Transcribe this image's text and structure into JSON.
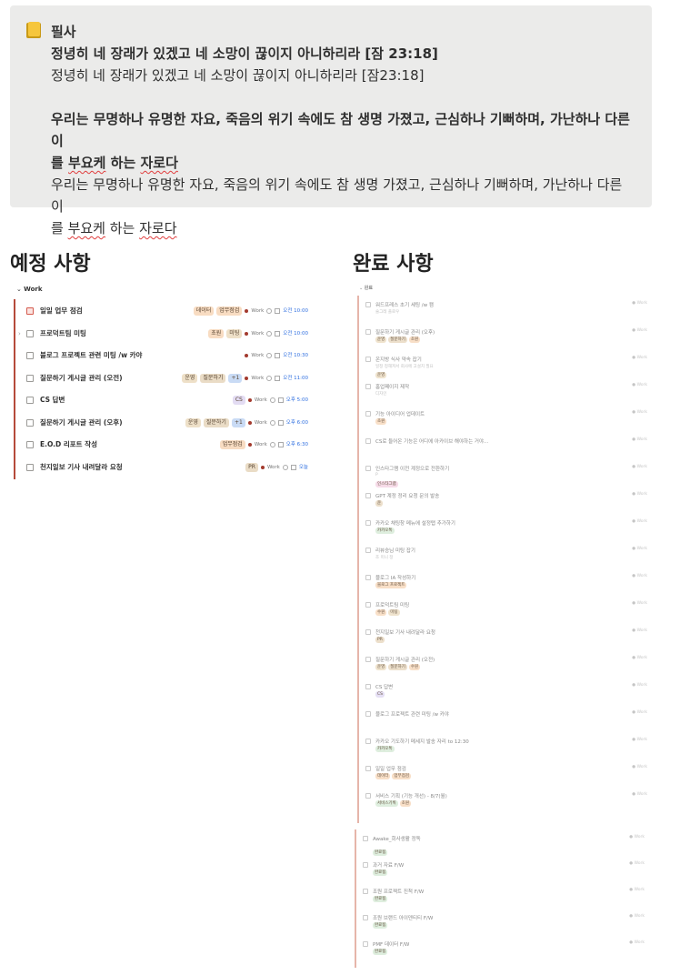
{
  "callout": {
    "icon": "notebook-icon",
    "title": "필사",
    "verse1_bold": "정녕히 네 장래가 있겠고 네 소망이 끊이지 아니하리라 [잠 23:18]",
    "verse1": "정녕히 네 장래가 있겠고 네 소망이 끊이지 아니하리라 [잠23:18]",
    "verse2_bold_a": "우리는 무명하나 유명한 자요, 죽음의 위기 속에도 참 생명 가졌고, 근심하나 기뻐하며, 가난하나 다른 이",
    "verse2_bold_b1": "를 ",
    "verse2_bold_b2": "부요케",
    "verse2_bold_b3": " 하는 ",
    "verse2_bold_b4": "자로다",
    "verse2_a": "우리는 무명하나 유명한 자요, 죽음의 위기 속에도 참 생명 가졌고, 근심하나 기뻐하며, 가난하나 다른 이",
    "verse2_b1": "를 ",
    "verse2_b2": "부요케",
    "verse2_b3": " 하는 ",
    "verse2_b4": "자로다"
  },
  "upcoming": {
    "heading": "예정 사항",
    "group": "Work",
    "rows": [
      {
        "name": "일일 업무 점검",
        "tags": [
          "데이터",
          "업무점검"
        ],
        "status": "Work",
        "time": "오전 10:00",
        "icon": "document-icon"
      },
      {
        "name": "프로덕트팀 미팅",
        "tags": [
          "초원",
          "미팅"
        ],
        "status": "Work",
        "time": "오전 10:00",
        "icon": "checkbox-icon"
      },
      {
        "name": "블로그 프로젝트 관련 미팅 /w 카야",
        "tags": [],
        "status": "Work",
        "time": "오전 10:30",
        "icon": "checkbox-icon"
      },
      {
        "name": "질문하기 게시글 관리 (오전)",
        "tags": [
          "운영",
          "질문하기",
          "+1"
        ],
        "status": "Work",
        "time": "오전 11:00",
        "icon": "checkbox-icon"
      },
      {
        "name": "CS 답변",
        "tags": [
          "CS"
        ],
        "status": "Work",
        "time": "오후 5:00",
        "icon": "checkbox-icon"
      },
      {
        "name": "질문하기 게시글 관리 (오후)",
        "tags": [
          "운영",
          "질문하기",
          "+1"
        ],
        "status": "Work",
        "time": "오후 6:00",
        "icon": "checkbox-icon"
      },
      {
        "name": "E.O.D 리포트 작성",
        "tags": [
          "업무점검"
        ],
        "status": "Work",
        "time": "오후 6:30",
        "icon": "checkbox-icon"
      },
      {
        "name": "천지일보 기사 내려달라 요청",
        "tags": [
          "PR"
        ],
        "status": "Work",
        "time": "오늘",
        "icon": "checkbox-icon"
      }
    ]
  },
  "done": {
    "heading": "완료 사항",
    "group": "완료",
    "rows": [
      {
        "name": "워드프레스 초기 세팅 /w 캠",
        "sub": "술그레 플로우",
        "tags": []
      },
      {
        "name": "질문하기 게시글 관리 (오후)",
        "sub": "",
        "tags": [
          "운영",
          "질문하기",
          "초원"
        ]
      },
      {
        "name": "온지방 식사 약속 잡기",
        "sub": "일정 정해져서 회사에 고설치 필요",
        "tags": [
          "운영"
        ]
      },
      {
        "name": "홈업페이지 제작",
        "sub": "디자인",
        "tags": []
      },
      {
        "name": "기능 아이디어 업데이트",
        "sub": "",
        "tags": [
          "초원"
        ]
      },
      {
        "name": "CS로 들어온 기능은 어디에 아카이브 해야하는 거야...",
        "sub": "",
        "tags": []
      },
      {
        "name": "인스타그램 이전 계정으로 전환하기",
        "sub": "P",
        "tags": [
          "인스타그램"
        ]
      },
      {
        "name": "GPT 계정 정리 요청 문의 발송",
        "sub": "",
        "tags": [
          "운"
        ]
      },
      {
        "name": "카카오 채팅창 메뉴에 설정탭 추가하기",
        "sub": "",
        "tags": [
          "카카오톡"
        ]
      },
      {
        "name": "리뷰승님 미팅 잡기",
        "sub": "조 미니 정",
        "tags": []
      },
      {
        "name": "블로그 IA 작성하기",
        "sub": "",
        "tags": [
          "블로그 프로젝트"
        ]
      },
      {
        "name": "프로덕트팀 미팅",
        "sub": "",
        "tags": [
          "수원",
          "미팅"
        ]
      },
      {
        "name": "천지일보 기사 내려달라 요청",
        "sub": "",
        "tags": [
          "PR"
        ]
      },
      {
        "name": "질문하기 게시글 관리 (오전)",
        "sub": "",
        "tags": [
          "운영",
          "질문하기",
          "수원"
        ]
      },
      {
        "name": "CS 답변",
        "sub": "",
        "tags": [
          "CS"
        ]
      },
      {
        "name": "블로그 프로젝트 관련 미팅 /w 카야",
        "sub": "",
        "tags": []
      },
      {
        "name": "카카오 기도하기 메세지 발송 자리 to 12:30",
        "sub": "",
        "tags": [
          "카카오톡"
        ]
      },
      {
        "name": "일일 업무 점검",
        "sub": "",
        "tags": [
          "데이터",
          "업무점검"
        ]
      },
      {
        "name": "서비스 기획 (기능 개선) - 8/7(월)",
        "sub": "",
        "tags": [
          "서비스기획",
          "초원"
        ]
      }
    ],
    "rows2": [
      {
        "name": "Awake_회사생활 정독",
        "tags": [
          "완료됨"
        ]
      },
      {
        "name": "과거 자료 F/W",
        "tags": [
          "완료됨"
        ]
      },
      {
        "name": "조원 프로젝트 진척 F/W",
        "tags": [
          "완료됨"
        ]
      },
      {
        "name": "조원 브랜드 아이덴티티 F/W",
        "tags": [
          "완료됨"
        ]
      },
      {
        "name": "PMF 데이터 F/W",
        "tags": [
          "완료됨"
        ]
      }
    ]
  }
}
